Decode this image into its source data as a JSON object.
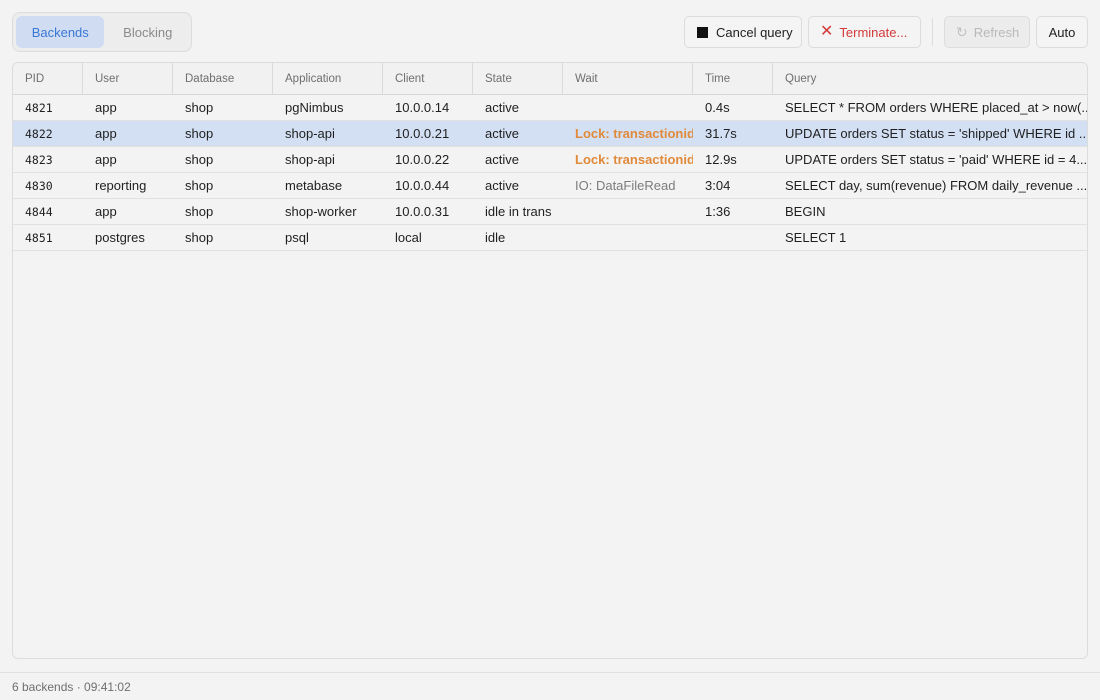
{
  "tabs": [
    {
      "label": "Backends",
      "active": true
    },
    {
      "label": "Blocking",
      "active": false
    }
  ],
  "toolbar": {
    "cancel_label": "Cancel query",
    "cancel_icon": "stop-square-icon",
    "terminate_label": "Terminate...",
    "terminate_icon": "close-x-icon",
    "refresh_label": "Refresh",
    "refresh_icon": "refresh-icon",
    "auto_label": "Auto"
  },
  "colors": {
    "accent": "#3b78d6",
    "selected_row": "#d3e0f4",
    "danger": "#d23b3b",
    "lock_wait": "#e08a3a"
  },
  "table": {
    "columns": [
      "PID",
      "User",
      "Database",
      "Application",
      "Client",
      "State",
      "Wait",
      "Time",
      "Query"
    ],
    "rows": [
      {
        "pid": "4821",
        "user": "app",
        "database": "shop",
        "application": "pgNimbus",
        "client": "10.0.0.14",
        "state": "active",
        "wait": "",
        "wait_type": "",
        "time": "0.4s",
        "query": "SELECT * FROM orders WHERE placed_at > now(...",
        "selected": false
      },
      {
        "pid": "4822",
        "user": "app",
        "database": "shop",
        "application": "shop-api",
        "client": "10.0.0.21",
        "state": "active",
        "wait": "Lock: transactionid",
        "wait_type": "lock",
        "time": "31.7s",
        "query": "UPDATE orders SET status = 'shipped' WHERE id ...",
        "selected": true
      },
      {
        "pid": "4823",
        "user": "app",
        "database": "shop",
        "application": "shop-api",
        "client": "10.0.0.22",
        "state": "active",
        "wait": "Lock: transactionid",
        "wait_type": "lock",
        "time": "12.9s",
        "query": "UPDATE orders SET status = 'paid' WHERE id = 4...",
        "selected": false
      },
      {
        "pid": "4830",
        "user": "reporting",
        "database": "shop",
        "application": "metabase",
        "client": "10.0.0.44",
        "state": "active",
        "wait": "IO: DataFileRead",
        "wait_type": "io",
        "time": "3:04",
        "query": "SELECT day, sum(revenue) FROM daily_revenue ...",
        "selected": false
      },
      {
        "pid": "4844",
        "user": "app",
        "database": "shop",
        "application": "shop-worker",
        "client": "10.0.0.31",
        "state": "idle in trans",
        "wait": "",
        "wait_type": "",
        "time": "1:36",
        "query": "BEGIN",
        "selected": false
      },
      {
        "pid": "4851",
        "user": "postgres",
        "database": "shop",
        "application": "psql",
        "client": "local",
        "state": "idle",
        "wait": "",
        "wait_type": "",
        "time": "",
        "query": "SELECT 1",
        "selected": false
      }
    ]
  },
  "status": {
    "text": "6 backends · 09:41:02"
  }
}
